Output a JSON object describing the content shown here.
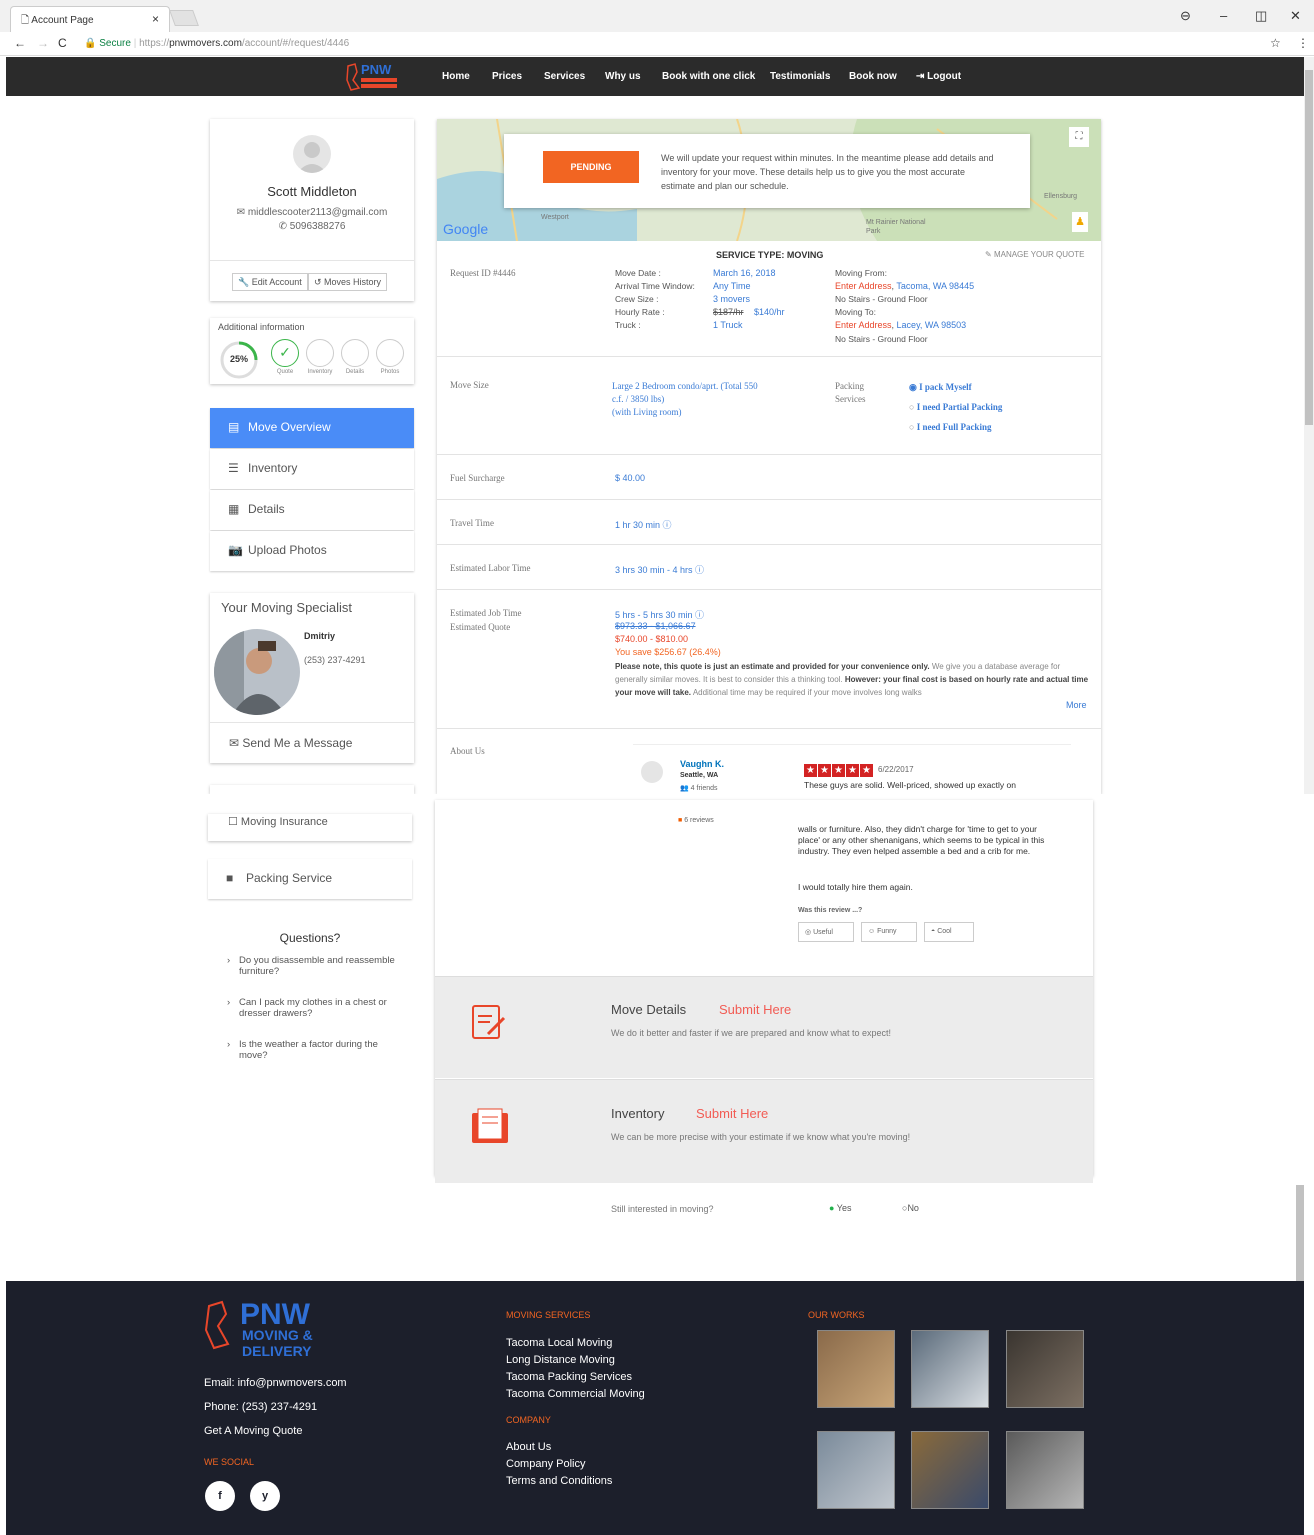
{
  "browser": {
    "tab_title": "Account Page",
    "tab_close": "×",
    "secure_label": "Secure",
    "url_scheme": "https://",
    "url_host": "pnwmovers.com",
    "url_path": "/account/#/request/4446"
  },
  "nav": {
    "logo_text": "PNW",
    "logo_sub": "MOVING & DELIVERY",
    "items": [
      "Home",
      "Prices",
      "Services",
      "Why us",
      "Book with one click",
      "Testimonials",
      "Book now"
    ],
    "logout": "Logout"
  },
  "profile": {
    "name": "Scott Middleton",
    "email": "middlescooter2113@gmail.com",
    "phone": "5096388276",
    "edit_account": "Edit Account",
    "moves_history": "Moves History"
  },
  "additional": {
    "title": "Additional information",
    "progress_label": "25%",
    "progress": 25,
    "steps": [
      "Quote",
      "Inventory",
      "Details",
      "Photos"
    ]
  },
  "menu": {
    "items": [
      "Move Overview",
      "Inventory",
      "Details",
      "Upload Photos"
    ],
    "active_color": "#4a8cf7"
  },
  "specialist": {
    "title": "Your Moving Specialist",
    "name": "Dmitriy",
    "phone": "(253) 237-4291",
    "send_message": "Send Me a Message"
  },
  "left_lower": {
    "moving_insurance": "Moving Insurance",
    "packing_service": "Packing Service",
    "questions_title": "Questions?",
    "questions": [
      "Do you disassemble and reassemble furniture?",
      "Can I pack my clothes in a chest or dresser drawers?",
      "Is the weather a factor during the move?"
    ]
  },
  "map": {
    "status": "PENDING",
    "message": "We will update your request within minutes. In the meantime please add details and inventory for your move. These details help us to give you the most accurate estimate and plan our schedule.",
    "google": "Google",
    "place1": "Ellensburg",
    "place2": "Mt Rainier National Park",
    "place3": "Westport",
    "status_color": "#f26522"
  },
  "request": {
    "service_type": "SERVICE TYPE: MOVING",
    "manage_quote": "MANAGE YOUR QUOTE",
    "request_id": "Request ID #4446",
    "move_date_label": "Move Date :",
    "move_date": "March 16, 2018",
    "arrival_label": "Arrival Time Window:",
    "arrival": "Any Time",
    "crew_label": "Crew Size :",
    "crew": "3 movers",
    "rate_label": "Hourly Rate :",
    "rate_old": "$187/hr",
    "rate_new": "$140/hr",
    "truck_label": "Truck :",
    "truck": "1 Truck",
    "from_label": "Moving From:",
    "from_enter": "Enter Address",
    "from_city": "Tacoma, WA 98445",
    "from_stairs": "No Stairs - Ground Floor",
    "to_label": "Moving To:",
    "to_enter": "Enter Address",
    "to_city": "Lacey, WA 98503",
    "to_stairs": "No Stairs - Ground Floor"
  },
  "move_size": {
    "label": "Move Size",
    "value_line1": "Large 2 Bedroom condo/aprt. (Total 550",
    "value_line2": "c.f. / 3850 lbs)",
    "value_line3": "(with Living room)",
    "packing_label1": "Packing",
    "packing_label2": "Services",
    "options": [
      "I pack Myself",
      "I need Partial Packing",
      "I need Full Packing"
    ],
    "selected": 0
  },
  "fuel": {
    "label": "Fuel Surcharge",
    "value": "$ 40.00"
  },
  "travel": {
    "label": "Travel Time",
    "value": "1 hr 30 min"
  },
  "labor": {
    "label": "Estimated Labor Time",
    "value": "3 hrs 30 min - 4 hrs"
  },
  "estimate": {
    "job_label": "Estimated Job Time",
    "quote_label": "Estimated Quote",
    "job_time": "5 hrs - 5 hrs 30 min",
    "old_quote": "$973.33 - $1,066.67",
    "new_quote": "$740.00 - $810.00",
    "save": "You save $256.67 (26.4%)",
    "note_bold1": "Please note, this quote is just an estimate and provided for your convenience only.",
    "note1": " We give you a database average for generally similar moves. It is best to consider this a thinking tool.",
    "note_bold2": " However: your final cost is based on hourly rate and actual time your move will take.",
    "note2": " Additional time may be required if your move involves long walks",
    "more": "More"
  },
  "about": {
    "label": "About Us",
    "reviewer": "Vaughn K.",
    "location": "Seattle, WA",
    "friends": "4 friends",
    "reviews": "6 reviews",
    "date": "6/22/2017",
    "text_top": "These guys are solid. Well-priced, showed up exactly on",
    "text_cont": "walls or furniture. Also, they didn't charge for 'time to get to your place' or any other shenanigans, which seems to be typical in this industry. They even helped assemble a bed and a crib for me.",
    "text_end": "I would totally hire them again.",
    "was_review": "Was this review ...?",
    "buttons": [
      "Useful",
      "Funny",
      "Cool"
    ],
    "rating": 5
  },
  "cta": [
    {
      "title": "Move Details",
      "action": "Submit Here",
      "desc": "We do it better and faster if we are prepared and know what to expect!"
    },
    {
      "title": "Inventory",
      "action": "Submit Here",
      "desc": "We can be more precise with your estimate if we know what you're moving!"
    }
  ],
  "interest": {
    "question": "Still interested in moving?",
    "yes": "Yes",
    "no": "No",
    "selected": "Yes"
  },
  "footer": {
    "logo": "PNW",
    "logo_sub1": "MOVING &",
    "logo_sub2": "DELIVERY",
    "email": "Email: info@pnwmovers.com",
    "phone": "Phone: (253) 237-4291",
    "quote": "Get A Moving Quote",
    "we_social": "WE SOCIAL",
    "services_head": "MOVING SERVICES",
    "services": [
      "Tacoma Local Moving",
      "Long Distance Moving",
      "Tacoma Packing Services",
      "Tacoma Commercial Moving"
    ],
    "company_head": "COMPANY",
    "company": [
      "About Us",
      "Company Policy",
      "Terms and Conditions"
    ],
    "works_head": "OUR WORKS",
    "social": [
      "f",
      "y"
    ]
  }
}
